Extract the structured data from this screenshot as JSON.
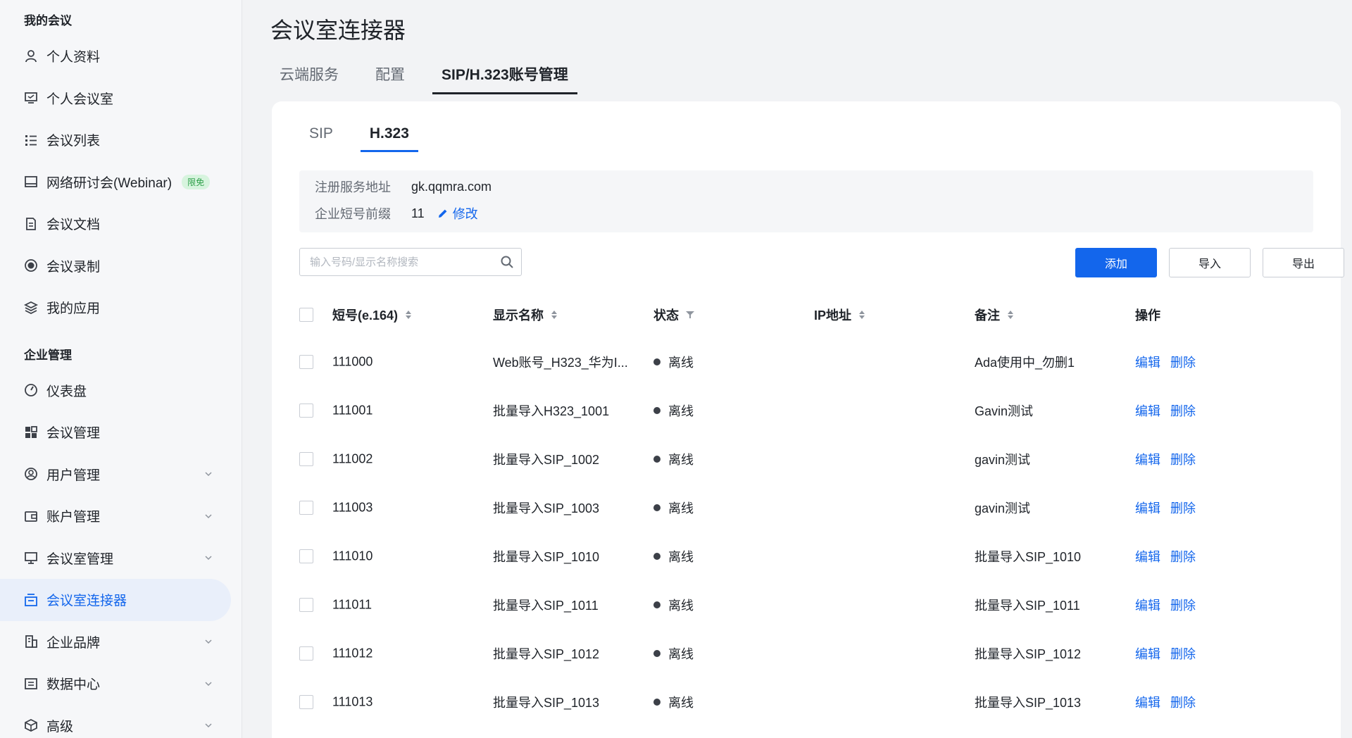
{
  "sidebar": {
    "section_mine": "我的会议",
    "section_enterprise": "企业管理",
    "mine_items": [
      {
        "label": "个人资料",
        "icon": "user-icon"
      },
      {
        "label": "个人会议室",
        "icon": "personal-room-icon"
      },
      {
        "label": "会议列表",
        "icon": "list-icon"
      },
      {
        "label": "网络研讨会(Webinar)",
        "icon": "webinar-icon",
        "badge": "限免"
      },
      {
        "label": "会议文档",
        "icon": "document-icon"
      },
      {
        "label": "会议录制",
        "icon": "record-icon"
      },
      {
        "label": "我的应用",
        "icon": "apps-icon"
      }
    ],
    "enterprise_items": [
      {
        "label": "仪表盘",
        "icon": "dashboard-icon"
      },
      {
        "label": "会议管理",
        "icon": "grid-icon"
      },
      {
        "label": "用户管理",
        "icon": "user-manage-icon",
        "expandable": true
      },
      {
        "label": "账户管理",
        "icon": "wallet-icon",
        "expandable": true
      },
      {
        "label": "会议室管理",
        "icon": "room-icon",
        "expandable": true
      },
      {
        "label": "会议室连接器",
        "icon": "connector-icon",
        "active": true
      },
      {
        "label": "企业品牌",
        "icon": "building-icon",
        "expandable": true
      },
      {
        "label": "数据中心",
        "icon": "data-icon",
        "expandable": true
      },
      {
        "label": "高级",
        "icon": "cube-icon",
        "expandable": true
      }
    ]
  },
  "main": {
    "title": "会议室连接器",
    "tabs": [
      {
        "label": "云端服务"
      },
      {
        "label": "配置"
      },
      {
        "label": "SIP/H.323账号管理",
        "active": true
      }
    ],
    "sub_tabs": [
      {
        "label": "SIP"
      },
      {
        "label": "H.323",
        "active": true
      }
    ],
    "info": {
      "register_label": "注册服务地址",
      "register_value": "gk.qqmra.com",
      "prefix_label": "企业短号前缀",
      "prefix_value": "11",
      "edit_label": "修改"
    },
    "search": {
      "placeholder": "输入号码/显示名称搜索"
    },
    "buttons": {
      "add": "添加",
      "import": "导入",
      "export": "导出"
    },
    "table": {
      "headers": {
        "number": "短号(e.164)",
        "name": "显示名称",
        "status": "状态",
        "ip": "IP地址",
        "note": "备注",
        "ops": "操作"
      },
      "edit_label": "编辑",
      "delete_label": "删除",
      "rows": [
        {
          "number": "111000",
          "name": "Web账号_H323_华为I...",
          "status": "离线",
          "ip": "",
          "note": "Ada使用中_勿删1"
        },
        {
          "number": "111001",
          "name": "批量导入H323_1001",
          "status": "离线",
          "ip": "",
          "note": "Gavin测试"
        },
        {
          "number": "111002",
          "name": "批量导入SIP_1002",
          "status": "离线",
          "ip": "",
          "note": "gavin测试"
        },
        {
          "number": "111003",
          "name": "批量导入SIP_1003",
          "status": "离线",
          "ip": "",
          "note": "gavin测试"
        },
        {
          "number": "111010",
          "name": "批量导入SIP_1010",
          "status": "离线",
          "ip": "",
          "note": "批量导入SIP_1010"
        },
        {
          "number": "111011",
          "name": "批量导入SIP_1011",
          "status": "离线",
          "ip": "",
          "note": "批量导入SIP_1011"
        },
        {
          "number": "111012",
          "name": "批量导入SIP_1012",
          "status": "离线",
          "ip": "",
          "note": "批量导入SIP_1012"
        },
        {
          "number": "111013",
          "name": "批量导入SIP_1013",
          "status": "离线",
          "ip": "",
          "note": "批量导入SIP_1013"
        }
      ]
    }
  },
  "colors": {
    "accent": "#1366ec",
    "badge_bg": "#d7f4de",
    "badge_text": "#2fa04a",
    "offline_dot": "#3c4048"
  }
}
